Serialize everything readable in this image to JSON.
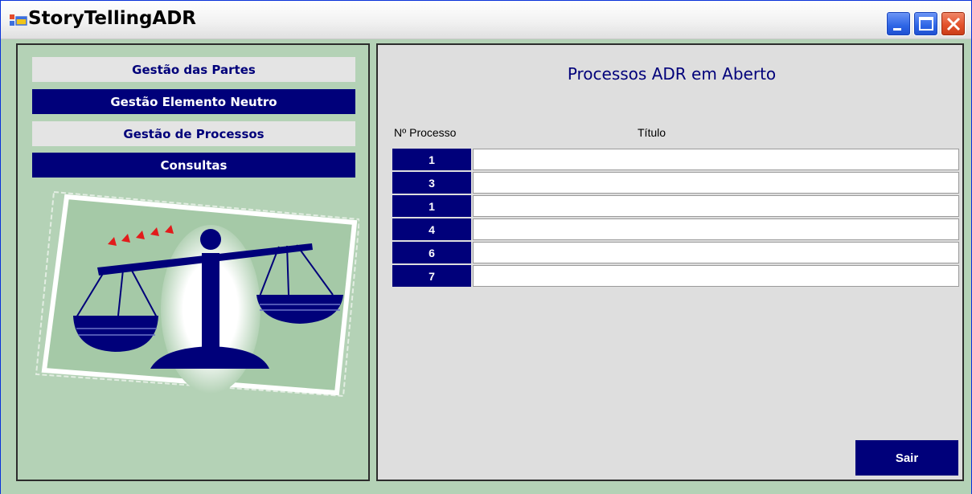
{
  "window": {
    "title": "StoryTellingADR",
    "icons": [
      "app-icon",
      "minimize-icon",
      "maximize-icon",
      "close-icon"
    ]
  },
  "colors": {
    "nav_dark": "#00007a",
    "panel_green": "#b4d2b6",
    "content_bg": "#dedede"
  },
  "sidebar": {
    "items": [
      {
        "label": "Gestão das Partes",
        "style": "light"
      },
      {
        "label": "Gestão Elemento Neutro",
        "style": "dark"
      },
      {
        "label": "Gestão de Processos",
        "style": "light"
      },
      {
        "label": "Consultas",
        "style": "dark"
      }
    ]
  },
  "main": {
    "heading": "Processos ADR em Aberto",
    "columns": {
      "number": "Nº Processo",
      "title": "Título"
    },
    "rows": [
      {
        "number": "1",
        "title": ""
      },
      {
        "number": "3",
        "title": ""
      },
      {
        "number": "1",
        "title": ""
      },
      {
        "number": "4",
        "title": ""
      },
      {
        "number": "6",
        "title": ""
      },
      {
        "number": "7",
        "title": ""
      }
    ],
    "exit_label": "Sair"
  }
}
